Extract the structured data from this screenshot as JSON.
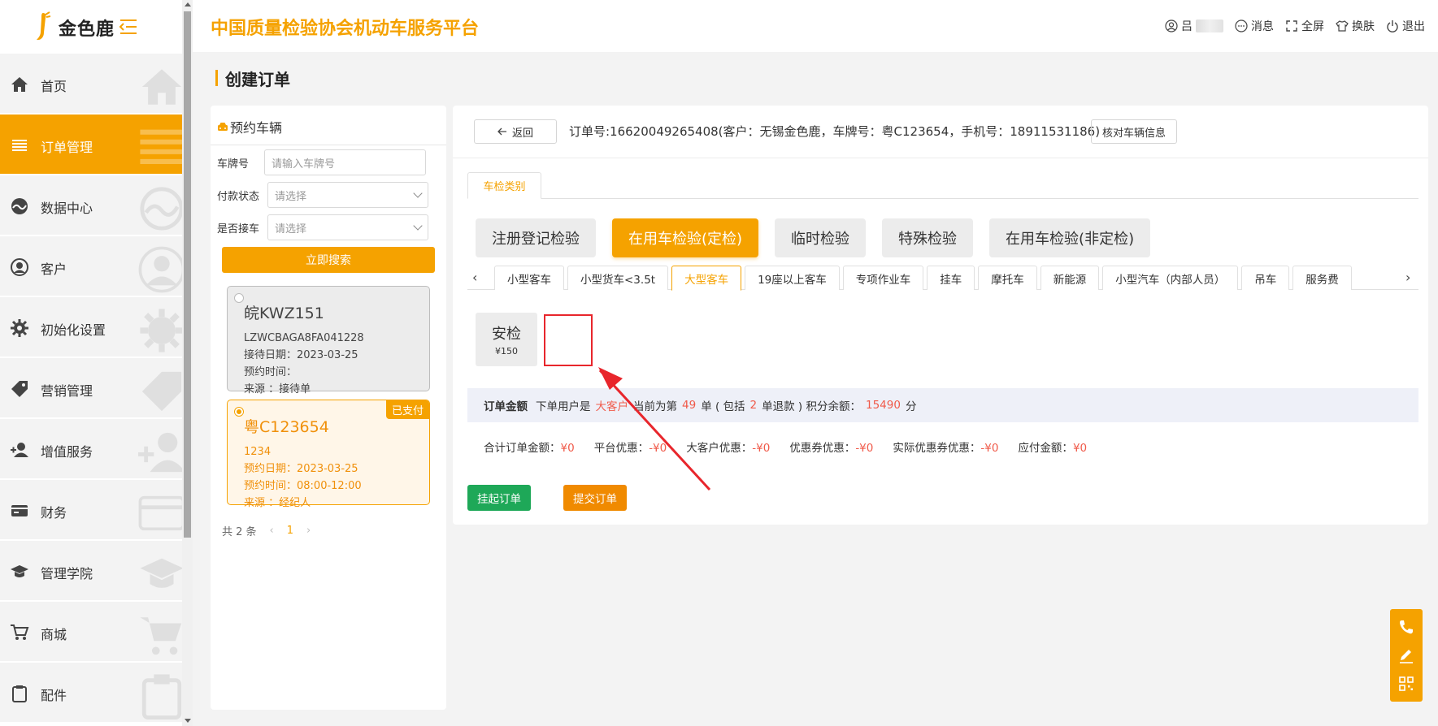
{
  "app": {
    "logo_text": "金色鹿",
    "platform_title": "中国质量检验协会机动车服务平台"
  },
  "header": {
    "user_label": "吕",
    "messages_label": "消息",
    "fullscreen_label": "全屏",
    "skin_label": "换肤",
    "logout_label": "退出"
  },
  "sidebar": {
    "items": [
      {
        "label": "首页",
        "icon": "home-icon"
      },
      {
        "label": "订单管理",
        "icon": "list-icon",
        "active": true
      },
      {
        "label": "数据中心",
        "icon": "chart-icon"
      },
      {
        "label": "客户",
        "icon": "user-icon"
      },
      {
        "label": "初始化设置",
        "icon": "gear-icon"
      },
      {
        "label": "营销管理",
        "icon": "tag-icon"
      },
      {
        "label": "增值服务",
        "icon": "add-user-icon"
      },
      {
        "label": "财务",
        "icon": "card-icon"
      },
      {
        "label": "管理学院",
        "icon": "graduation-cap-icon"
      },
      {
        "label": "商城",
        "icon": "cart-icon"
      },
      {
        "label": "配件",
        "icon": "clipboard-icon"
      }
    ]
  },
  "page": {
    "title": "创建订单"
  },
  "reservation": {
    "header": "预约车辆",
    "plate_label": "车牌号",
    "plate_placeholder": "请输入车牌号",
    "pay_status_label": "付款状态",
    "pay_status_placeholder": "请选择",
    "received_label": "是否接车",
    "received_placeholder": "请选择",
    "search_label": "立即搜索",
    "cards": [
      {
        "plate": "皖KWZ151",
        "vin": "LZWCBAGA8FA041228",
        "date_line": "接待日期：2023-03-25",
        "time_line": "预约时间：",
        "source_line": "来源 ：接待单",
        "selected": false
      },
      {
        "plate": "粤C123654",
        "vin": "1234",
        "date_line": "预约日期：2023-03-25",
        "time_line": "预约时间：08:00-12:00",
        "source_line": "来源 ：经纪人",
        "badge": "已支付",
        "selected": true
      }
    ],
    "pager": {
      "total": "共 2 条",
      "current": "1"
    }
  },
  "order": {
    "back_label": "返回",
    "info": "订单号:16620049265408(客户：无锡金色鹿，车牌号：粤C123654，手机号：18911531186)",
    "verify_label": "核对车辆信息",
    "category_tab": "车检类别",
    "inspection_types": [
      {
        "label": "注册登记检验",
        "active": false
      },
      {
        "label": "在用车检验(定检)",
        "active": true
      },
      {
        "label": "临时检验",
        "active": false
      },
      {
        "label": "特殊检验",
        "active": false
      },
      {
        "label": "在用车检验(非定检)",
        "active": false
      }
    ],
    "vehicle_tabs": [
      {
        "label": "小型客车",
        "active": false
      },
      {
        "label": "小型货车<3.5t",
        "active": false
      },
      {
        "label": "大型客车",
        "active": true
      },
      {
        "label": "19座以上客车",
        "active": false
      },
      {
        "label": "专项作业车",
        "active": false
      },
      {
        "label": "挂车",
        "active": false
      },
      {
        "label": "摩托车",
        "active": false
      },
      {
        "label": "新能源",
        "active": false
      },
      {
        "label": "小型汽车（内部人员）",
        "active": false
      },
      {
        "label": "吊车",
        "active": false
      },
      {
        "label": "服务费",
        "active": false
      }
    ],
    "service": {
      "name": "安检",
      "price": "¥150"
    },
    "summary": {
      "title": "订单金额",
      "user_prefix": "下单用户是",
      "user_type": "大客户",
      "count_prefix": "当前为第",
      "count": "49",
      "count_mid": "单 ( 包括",
      "refund_count": "2",
      "refund_suffix": "单退款 ) 积分余额：",
      "points": "15490",
      "points_suffix": "分"
    },
    "amounts": [
      {
        "label": "合计订单金额：",
        "value": "¥0"
      },
      {
        "label": "平台优惠：",
        "value": "-¥0"
      },
      {
        "label": "大客户优惠：",
        "value": "-¥0"
      },
      {
        "label": "优惠券优惠：",
        "value": "-¥0"
      },
      {
        "label": "实际优惠券优惠：",
        "value": "-¥0"
      },
      {
        "label": "应付金额：",
        "value": "¥0"
      }
    ],
    "hold_label": "挂起订单",
    "submit_label": "提交订单"
  },
  "colors": {
    "accent": "#f5a200",
    "highlight": "#e8262c",
    "amount_red": "#f05a4a",
    "green": "#1ea858"
  }
}
